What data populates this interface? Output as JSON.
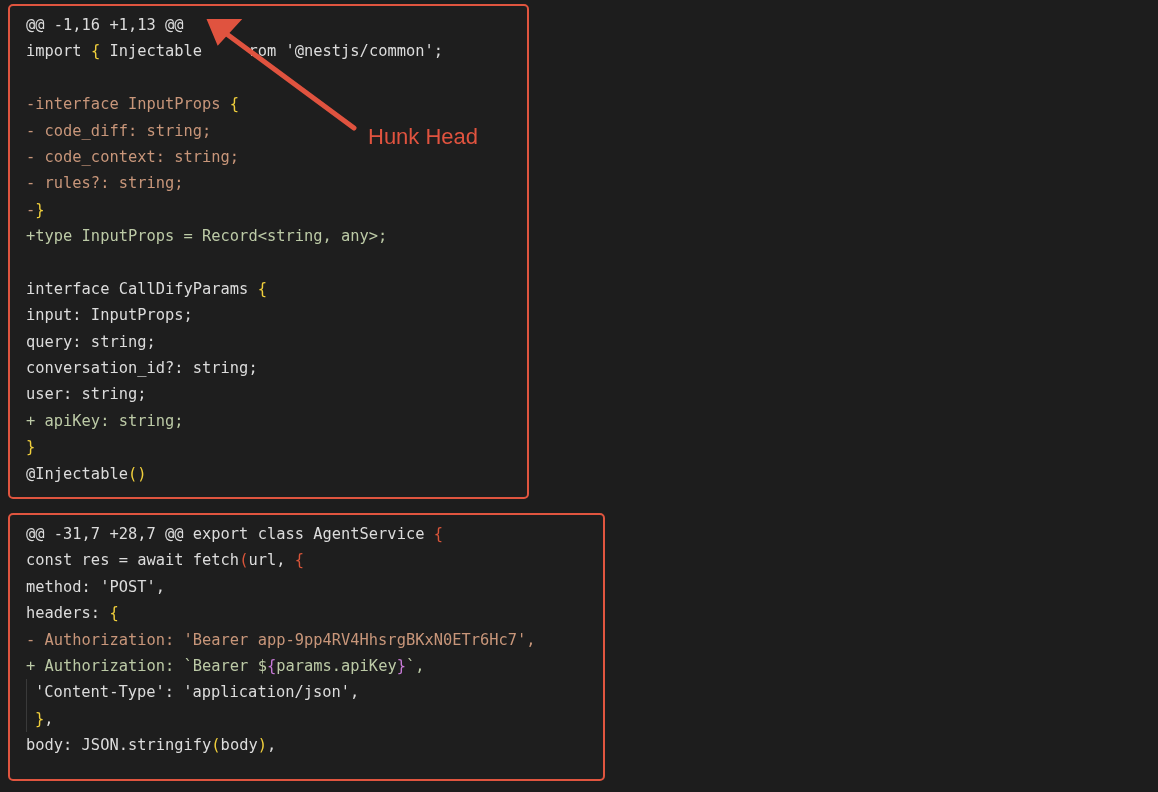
{
  "hunks": [
    {
      "lines": [
        {
          "kind": "hunk",
          "tokens": [
            {
              "text": "@@ -1,16 +1,13 @@",
              "kind": "plain"
            }
          ]
        },
        {
          "kind": "context",
          "tokens": [
            {
              "text": "import ",
              "kind": "plain"
            },
            {
              "text": "{",
              "kind": "brace"
            },
            {
              "text": " Injectable",
              "kind": "plain"
            },
            {
              "text": "rom '@nestjs/common';",
              "kind": "plain",
              "covered_before": true
            }
          ]
        },
        {
          "kind": "blank"
        },
        {
          "kind": "removed",
          "tokens": [
            {
              "text": "-interface InputProps ",
              "kind": "plain"
            },
            {
              "text": "{",
              "kind": "brace"
            }
          ]
        },
        {
          "kind": "removed",
          "tokens": [
            {
              "text": "- code_diff: string;",
              "kind": "plain"
            }
          ]
        },
        {
          "kind": "removed",
          "tokens": [
            {
              "text": "- code_context: string;",
              "kind": "plain"
            }
          ]
        },
        {
          "kind": "removed",
          "tokens": [
            {
              "text": "- rules?: string;",
              "kind": "plain"
            }
          ]
        },
        {
          "kind": "removed",
          "tokens": [
            {
              "text": "-",
              "kind": "plain"
            },
            {
              "text": "}",
              "kind": "brace"
            }
          ]
        },
        {
          "kind": "added",
          "tokens": [
            {
              "text": "+type InputProps = Record<string, any>;",
              "kind": "plain"
            }
          ]
        },
        {
          "kind": "blank"
        },
        {
          "kind": "context",
          "tokens": [
            {
              "text": "interface CallDifyParams ",
              "kind": "plain"
            },
            {
              "text": "{",
              "kind": "brace"
            }
          ]
        },
        {
          "kind": "context",
          "tokens": [
            {
              "text": "input: InputProps;",
              "kind": "plain"
            }
          ]
        },
        {
          "kind": "context",
          "tokens": [
            {
              "text": "query: string;",
              "kind": "plain"
            }
          ]
        },
        {
          "kind": "context",
          "tokens": [
            {
              "text": "conversation_id?: string;",
              "kind": "plain"
            }
          ]
        },
        {
          "kind": "context",
          "tokens": [
            {
              "text": "user: string;",
              "kind": "plain"
            }
          ]
        },
        {
          "kind": "added",
          "tokens": [
            {
              "text": "+ apiKey: string;",
              "kind": "plain"
            }
          ]
        },
        {
          "kind": "context",
          "tokens": [
            {
              "text": "}",
              "kind": "brace"
            }
          ]
        },
        {
          "kind": "context",
          "tokens": [
            {
              "text": "@Injectable",
              "kind": "plain"
            },
            {
              "text": "()",
              "kind": "brace"
            }
          ]
        }
      ]
    },
    {
      "lines": [
        {
          "kind": "hunk",
          "tokens": [
            {
              "text": "@@ -31,7 +28,7 @@ export class AgentService ",
              "kind": "plain"
            },
            {
              "text": "{",
              "kind": "outer"
            }
          ]
        },
        {
          "kind": "context",
          "tokens": [
            {
              "text": "const res = await fetch",
              "kind": "plain"
            },
            {
              "text": "(",
              "kind": "outer"
            },
            {
              "text": "url, ",
              "kind": "plain"
            },
            {
              "text": "{",
              "kind": "outer"
            }
          ]
        },
        {
          "kind": "context",
          "tokens": [
            {
              "text": "method: 'POST',",
              "kind": "plain"
            }
          ]
        },
        {
          "kind": "context",
          "tokens": [
            {
              "text": "headers: ",
              "kind": "plain"
            },
            {
              "text": "{",
              "kind": "brace"
            }
          ]
        },
        {
          "kind": "removed",
          "tokens": [
            {
              "text": "- Authorization: 'Bearer app-9pp4RV4HhsrgBKxN0ETr6Hc7',",
              "kind": "plain"
            }
          ]
        },
        {
          "kind": "added",
          "tokens": [
            {
              "text": "+ Authorization: `Bearer $",
              "kind": "plain"
            },
            {
              "text": "{",
              "kind": "interp"
            },
            {
              "text": "params.apiKey",
              "kind": "plain"
            },
            {
              "text": "}",
              "kind": "interp"
            },
            {
              "text": "`,",
              "kind": "plain"
            }
          ]
        },
        {
          "kind": "context",
          "guide": true,
          "tokens": [
            {
              "text": "'Content-Type': 'application/json',",
              "kind": "plain"
            }
          ]
        },
        {
          "kind": "context",
          "guide": true,
          "tokens": [
            {
              "text": "}",
              "kind": "brace"
            },
            {
              "text": ",",
              "kind": "plain"
            }
          ]
        },
        {
          "kind": "context",
          "tokens": [
            {
              "text": "body: JSON.stringify",
              "kind": "plain"
            },
            {
              "text": "(",
              "kind": "brace"
            },
            {
              "text": "body",
              "kind": "plain"
            },
            {
              "text": ")",
              "kind": "brace"
            },
            {
              "text": ",",
              "kind": "plain"
            }
          ]
        }
      ]
    }
  ],
  "annotation": {
    "label": "Hunk Head"
  }
}
